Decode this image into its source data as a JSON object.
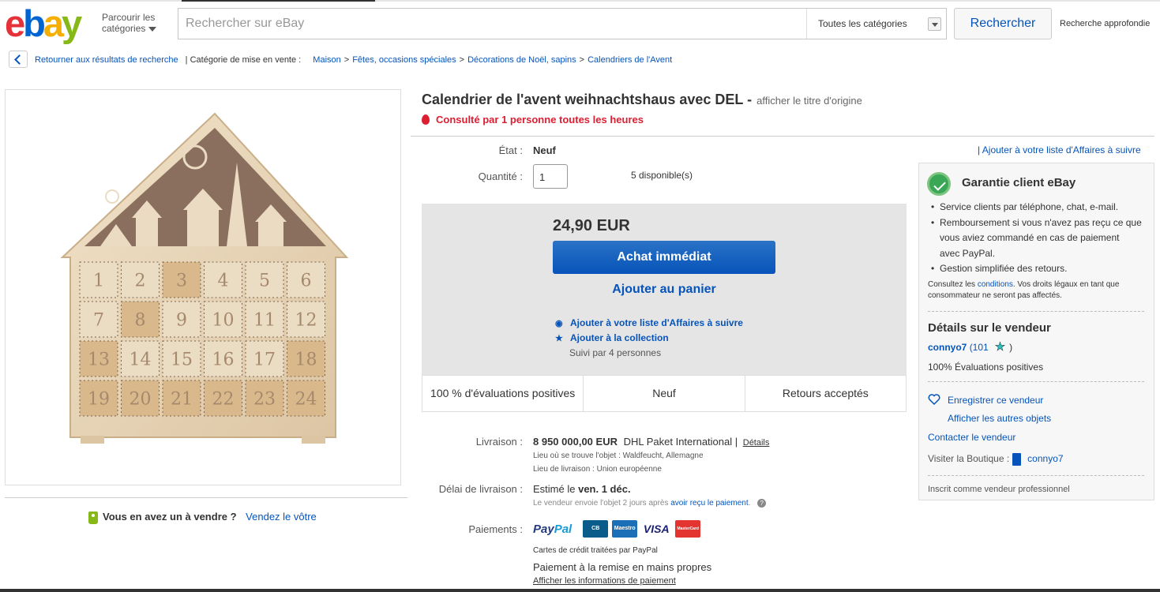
{
  "header": {
    "logo_e": "e",
    "logo_b": "b",
    "logo_a": "a",
    "logo_y": "y",
    "browse_line1": "Parcourir les",
    "browse_line2": "catégories",
    "search_placeholder": "Rechercher sur eBay",
    "category": "Toutes les catégories",
    "search_button": "Rechercher",
    "advanced": "Recherche approfondie"
  },
  "breadcrumb": {
    "back": "Retourner aux résultats de recherche",
    "category_label": "| Catégorie de mise en vente :",
    "items": [
      "Maison",
      "Fêtes, occasions spéciales",
      "Décorations de Noël, sapins",
      "Calendriers de l'Avent"
    ]
  },
  "image": {
    "numbers": [
      "1",
      "2",
      "3",
      "4",
      "5",
      "6",
      "7",
      "8",
      "9",
      "10",
      "11",
      "12",
      "13",
      "14",
      "15",
      "16",
      "17",
      "18",
      "19",
      "20",
      "21",
      "22",
      "23",
      "24"
    ]
  },
  "sell": {
    "question": "Vous en avez un à vendre ?",
    "link": "Vendez le vôtre"
  },
  "item": {
    "title": "Calendrier de l'avent weihnachtshaus avec DEL -",
    "original_title": "afficher le titre d'origine",
    "viewed": "Consulté par 1 personne toutes les heures",
    "condition_label": "État :",
    "condition": "Neuf",
    "quantity_label": "Quantité :",
    "quantity": "1",
    "available": "5 disponible(s)",
    "watch_top": "|  Ajouter à votre liste d'Affaires à suivre"
  },
  "buy": {
    "price": "24,90 EUR",
    "buy_now": "Achat immédiat",
    "add_cart": "Ajouter au panier",
    "watch": "Ajouter à votre liste d'Affaires à suivre",
    "collection": "Ajouter à la collection",
    "followed": "Suivi par 4 personnes",
    "badges": [
      "100 % d'évaluations positives",
      "Neuf",
      "Retours acceptés"
    ]
  },
  "shipping": {
    "label": "Livraison :",
    "cost": "8 950 000,00 EUR",
    "carrier": "DHL Paket International |",
    "details": "Détails",
    "location": "Lieu où se trouve l'objet : Waldfeucht, Allemagne",
    "ships_to": "Lieu de livraison : Union européenne",
    "delay_label": "Délai de livraison :",
    "delay_prefix": "Estimé le",
    "delay_date": "ven. 1 déc.",
    "delay_note": "Le vendeur envoie l'objet 2 jours après",
    "delay_link": "avoir reçu le paiement",
    "delay_end": ".",
    "help": "?"
  },
  "payments": {
    "label": "Paiements :",
    "paypal_a": "Pay",
    "paypal_b": "Pal",
    "cards": [
      "CB",
      "Maestro",
      "VISA",
      "MasterCard"
    ],
    "note": "Cartes de crédit traitées par PayPal",
    "pickup": "Paiement à la remise en mains propres",
    "info_link": "Afficher les informations de paiement"
  },
  "guarantee": {
    "title": "Garantie client eBay",
    "items": [
      "Service clients par téléphone, chat, e-mail.",
      "Remboursement si vous n'avez pas reçu ce que vous aviez commandé en cas de paiement avec PayPal.",
      "Gestion simplifiée des retours."
    ],
    "note_prefix": "Consultez les",
    "note_link": "conditions",
    "note_suffix": ". Vos droits légaux en tant que consommateur ne seront pas affectés."
  },
  "seller": {
    "title": "Détails sur le vendeur",
    "name": "connyo7",
    "score": "(101",
    "score_end": ")",
    "feedback": "100% Évaluations positives",
    "save": "Enregistrer ce vendeur",
    "other_items": "Afficher les autres objets",
    "contact": "Contacter le vendeur",
    "store_label": "Visiter la Boutique :",
    "store_name": "connyo7",
    "pro": "Inscrit comme vendeur professionnel"
  },
  "colors": {
    "accent": "#0654ba",
    "alert": "#dd1e31",
    "wood_light": "#ead6b8",
    "wood_dark": "#8a6f5e"
  }
}
